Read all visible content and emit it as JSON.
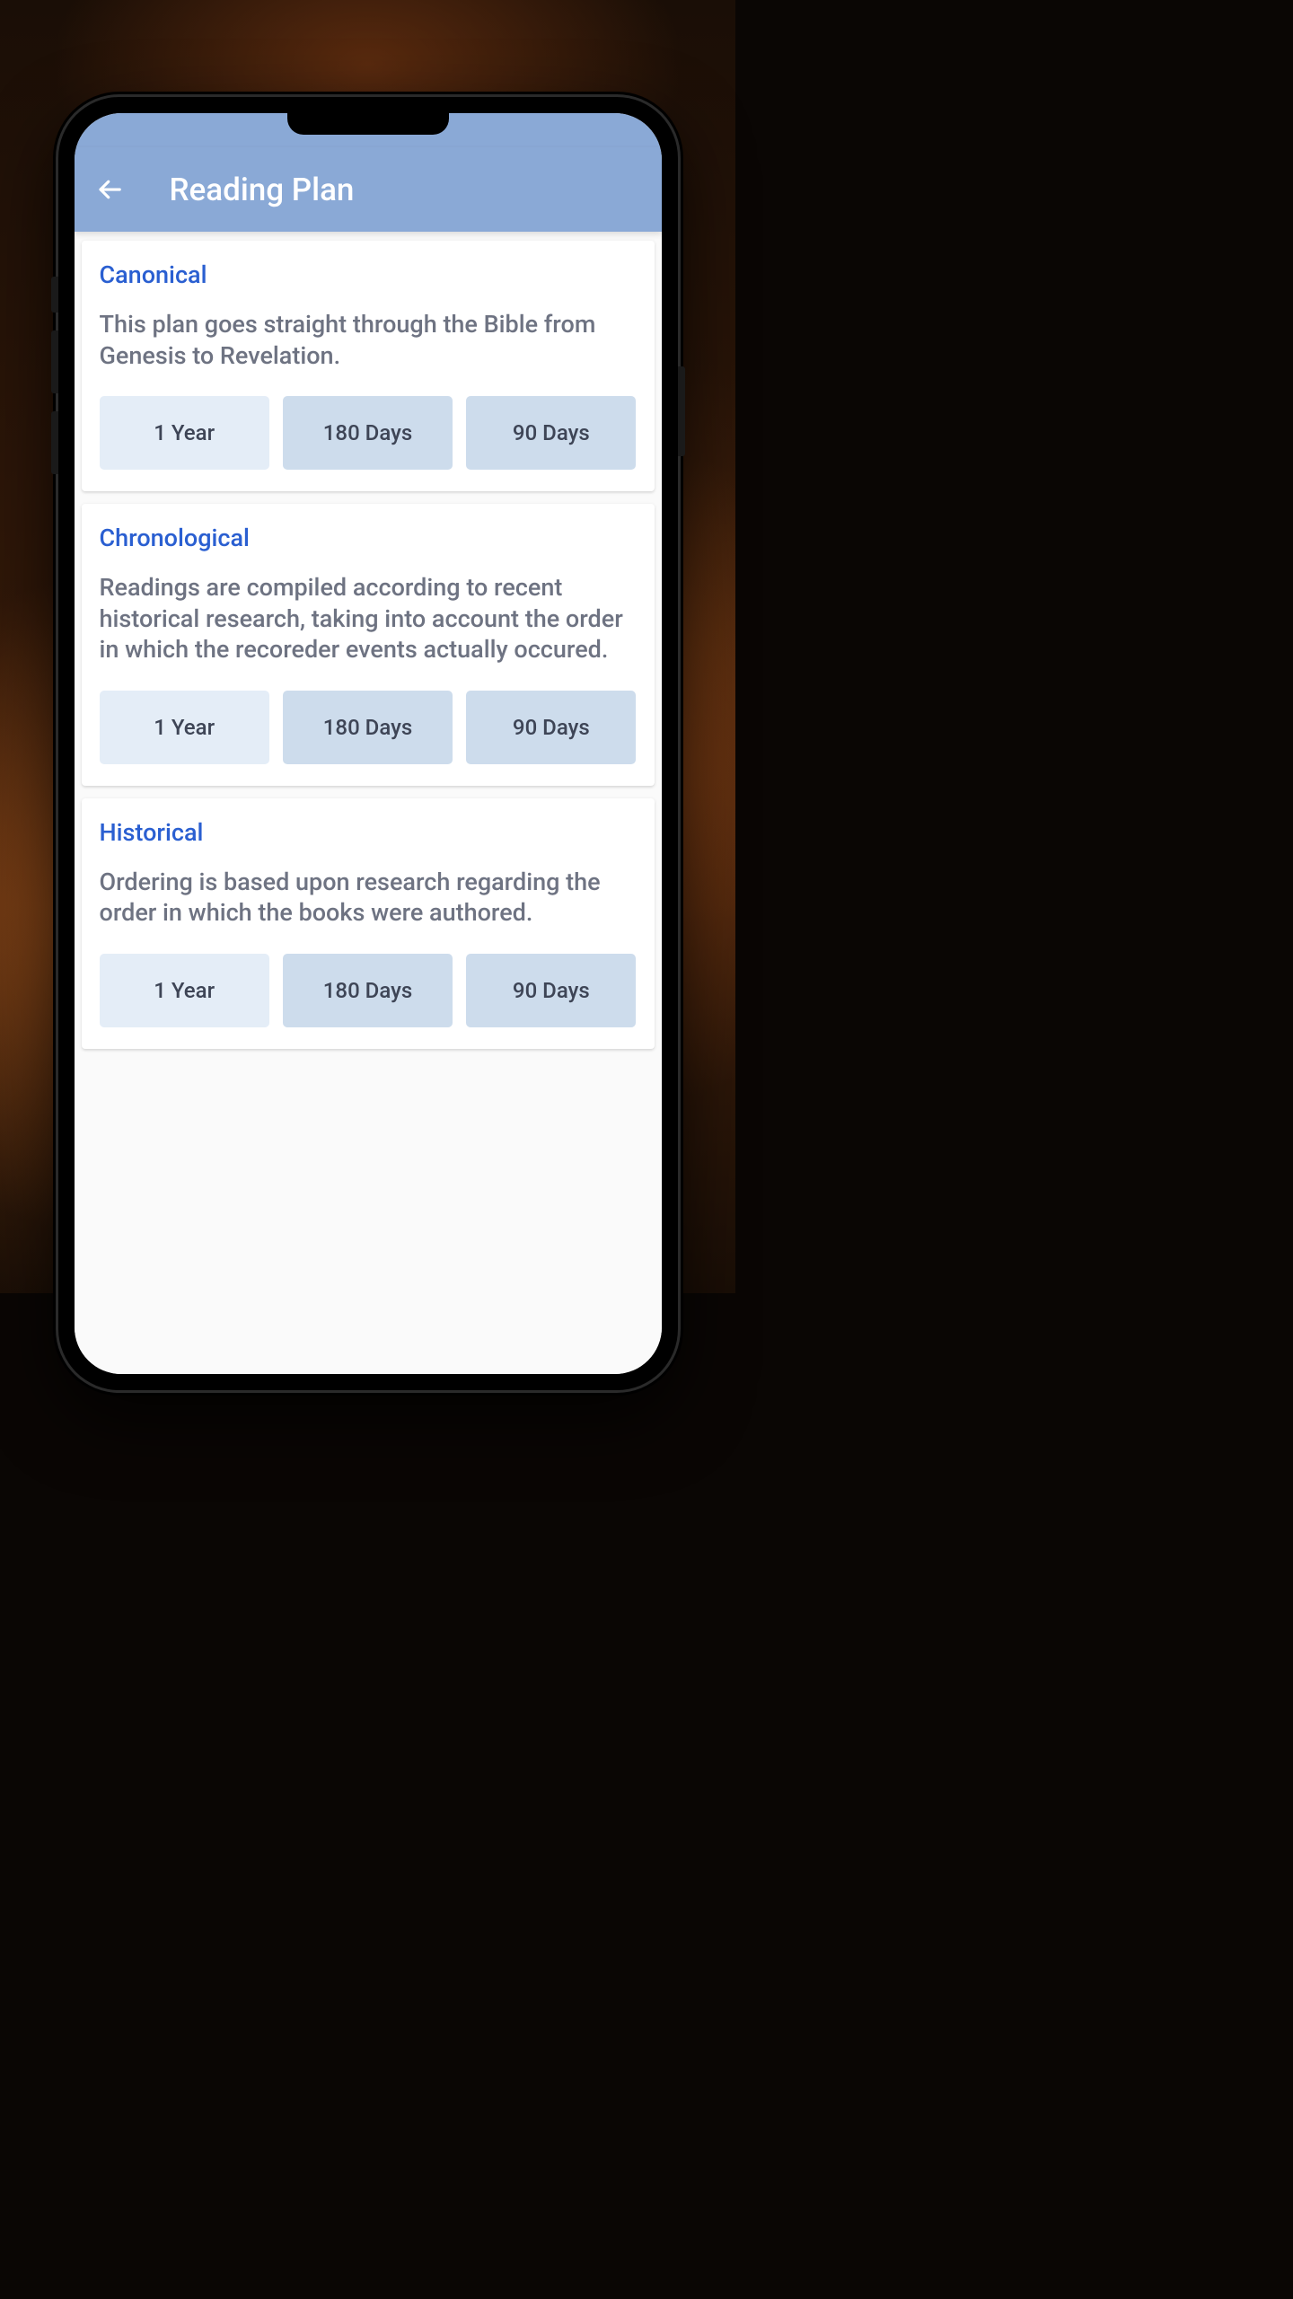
{
  "header": {
    "title": "Reading Plan"
  },
  "plans": [
    {
      "title": "Canonical",
      "description": "This plan goes straight through the Bible from Genesis to Revelation.",
      "durations": [
        "1 Year",
        "180 Days",
        "90 Days"
      ]
    },
    {
      "title": "Chronological",
      "description": "Readings are compiled according to recent historical research, taking into account the order in which the recoreder events actually occured.",
      "durations": [
        "1 Year",
        "180 Days",
        "90 Days"
      ]
    },
    {
      "title": "Historical",
      "description": "Ordering is based upon research regarding the order in which the books were authored.",
      "durations": [
        "1 Year",
        "180 Days",
        "90 Days"
      ]
    }
  ]
}
